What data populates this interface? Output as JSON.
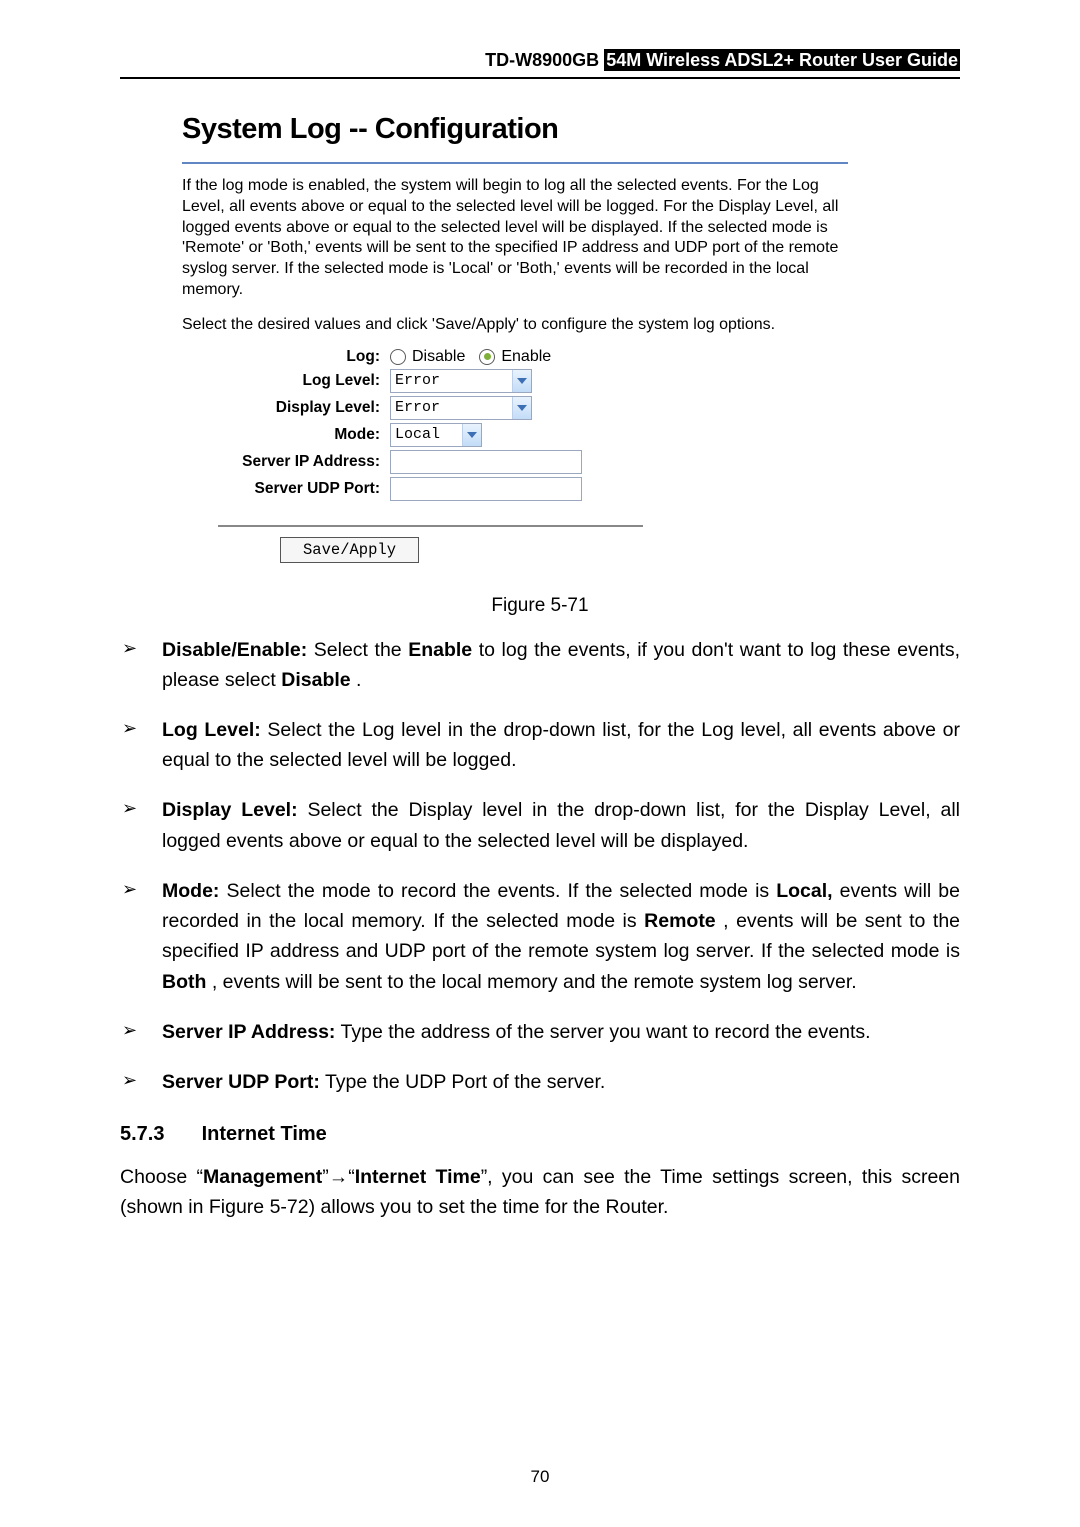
{
  "header": {
    "model": "TD-W8900GB",
    "guide": "54M  Wireless  ADSL2+  Router  User  Guide"
  },
  "shot": {
    "title": "System Log -- Configuration",
    "para1": "If the log mode is enabled, the system will begin to log all the selected events. For the Log Level, all events above or equal to the selected level will be logged. For the Display Level, all logged events above or equal to the selected level will be displayed. If the selected mode is 'Remote' or 'Both,' events will be sent to the specified IP address and UDP port of the remote syslog server. If the selected mode is 'Local' or 'Both,' events will be recorded in the local memory.",
    "para2": "Select the desired values and click 'Save/Apply' to configure the system log options.",
    "labels": {
      "log": "Log:",
      "loglevel": "Log Level:",
      "displaylevel": "Display Level:",
      "mode": "Mode:",
      "serverip": "Server IP Address:",
      "serverport": "Server UDP Port:"
    },
    "radio_disable": "Disable",
    "radio_enable": "Enable",
    "sel_loglevel": "Error",
    "sel_displaylevel": "Error",
    "sel_mode": "Local",
    "btn_apply": "Save/Apply"
  },
  "figcap": "Figure 5-71",
  "bullets": {
    "b1_label": "Disable/Enable:",
    "b1_enable": "Enable",
    "b1_disable": "Disable",
    "b1_text_a": " Select the ",
    "b1_text_b": " to log the events, if you don't want to log these events, please select ",
    "b1_text_c": ".",
    "b2_label": "Log Level:",
    "b2_text": " Select the Log level in the drop-down list, for the Log level, all events above or equal to the selected level will be logged.",
    "b3_label": "Display Level:",
    "b3_text": " Select the Display level in the drop-down list, for the Display Level, all logged events above or equal to the selected level will be displayed.",
    "b4_label": "Mode:",
    "b4_text_a": " Select the mode to record the events. If the selected mode is ",
    "b4_local": "Local,",
    "b4_text_b": " events will be recorded in the local memory. If the selected mode is ",
    "b4_remote": "Remote",
    "b4_text_c": ", events will be sent to the specified IP address and UDP port of the remote system log server. If the selected mode is ",
    "b4_both": "Both",
    "b4_text_d": ", events will be sent to the local memory and the remote system log server.",
    "b5_label": "Server IP Address:",
    "b5_text": " Type the address of the server you want to record the events.",
    "b6_label": "Server UDP Port:",
    "b6_text": " Type the UDP Port of the server."
  },
  "section": {
    "num": "5.7.3",
    "title": "Internet Time",
    "choose_a": "Choose “",
    "management": "Management",
    "quote_arrow_quote": "”→“",
    "internettime": "Internet Time",
    "choose_b": "”, you can see the Time settings screen, this screen (shown in ",
    "figref": "Figure 5-72",
    "choose_c": ") allows you to set the time for the Router."
  },
  "page_number": "70"
}
